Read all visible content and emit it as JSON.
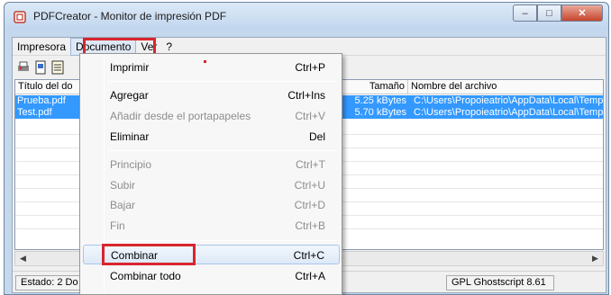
{
  "window": {
    "title": "PDFCreator - Monitor de impresión PDF",
    "min_label": "–",
    "max_label": "□",
    "close_label": "✕"
  },
  "menubar": {
    "items": [
      "Impresora",
      "Documento",
      "Ver",
      "?"
    ],
    "open_item": "Documento"
  },
  "toolbar": {
    "icons": [
      "printer-icon",
      "document-icon",
      "list-icon"
    ]
  },
  "grid": {
    "columns": [
      "Título del do",
      "Tamaño",
      "Nombre del archivo"
    ],
    "rows": [
      {
        "title": "Prueba.pdf",
        "size": "5.25 kBytes",
        "filename": "C:\\Users\\Propoieatrio\\AppData\\Local\\Temp"
      },
      {
        "title": "Test.pdf",
        "size": "5.70 kBytes",
        "filename": "C:\\Users\\Propoieatrio\\AppData\\Local\\Temp"
      }
    ]
  },
  "status": {
    "left": "Estado: 2 Do",
    "right": "GPL Ghostscript 8.61"
  },
  "dropdown": {
    "items": [
      {
        "label": "Imprimir",
        "shortcut": "Ctrl+P",
        "enabled": true
      },
      {
        "label": "Agregar",
        "shortcut": "Ctrl+Ins",
        "enabled": true
      },
      {
        "label": "Añadir desde el portapapeles",
        "shortcut": "Ctrl+V",
        "enabled": false
      },
      {
        "label": "Eliminar",
        "shortcut": "Del",
        "enabled": true
      },
      {
        "label": "Principio",
        "shortcut": "Ctrl+T",
        "enabled": false
      },
      {
        "label": "Subir",
        "shortcut": "Ctrl+U",
        "enabled": false
      },
      {
        "label": "Bajar",
        "shortcut": "Ctrl+D",
        "enabled": false
      },
      {
        "label": "Fin",
        "shortcut": "Ctrl+B",
        "enabled": false
      },
      {
        "label": "Combinar",
        "shortcut": "Ctrl+C",
        "enabled": true
      },
      {
        "label": "Combinar todo",
        "shortcut": "Ctrl+A",
        "enabled": true
      }
    ],
    "highlighted": "Combinar"
  },
  "colors": {
    "selection": "#3399ff",
    "highlight_box": "#d9252e"
  }
}
